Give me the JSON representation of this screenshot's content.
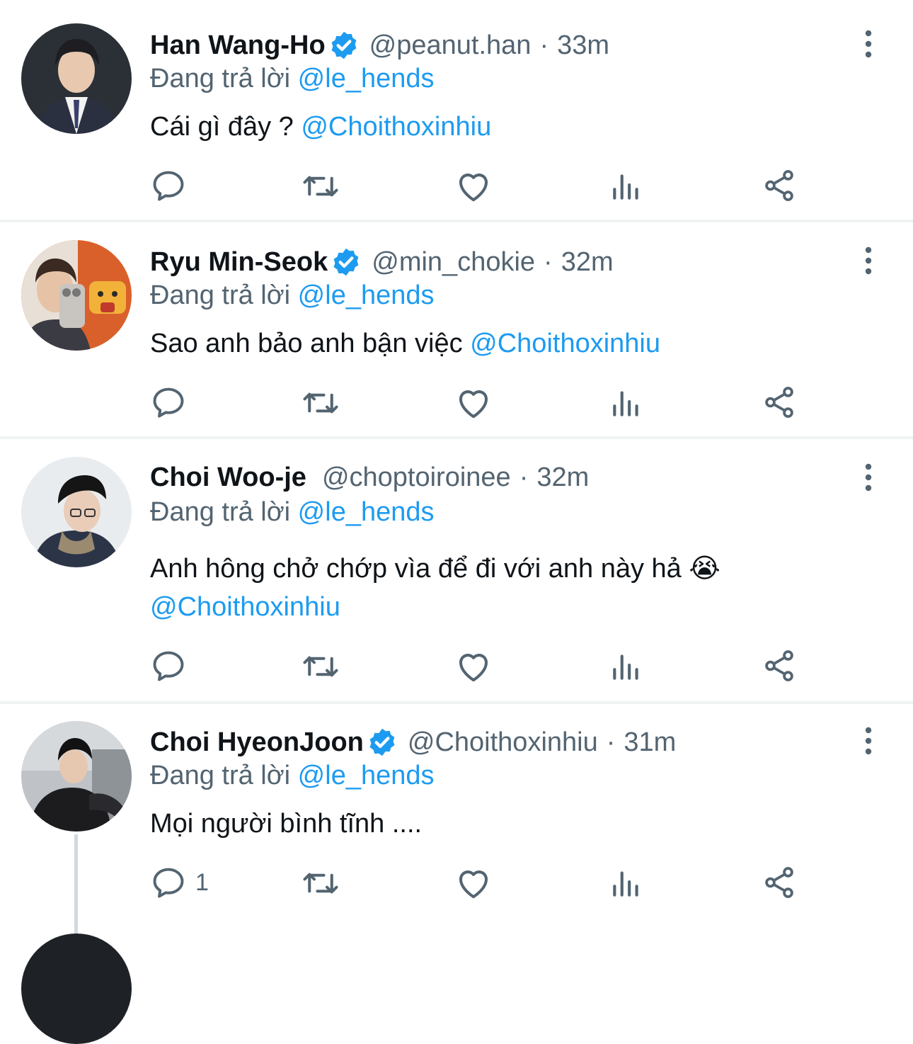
{
  "colors": {
    "accent": "#1d9bf0",
    "secondary_text": "#536471",
    "divider": "#eff3f4",
    "verified": "#1d9bf0"
  },
  "tweets": [
    {
      "display_name": "Han Wang-Ho",
      "verified": true,
      "handle": "@peanut.han",
      "separator": "·",
      "time": "33m",
      "reply_prefix": "Đang trả lời",
      "reply_handle": "@le_hends",
      "text": "Cái gì đây ?",
      "text_mention": "@Choithoxinhiu",
      "reply_count": ""
    },
    {
      "display_name": "Ryu Min-Seok",
      "verified": true,
      "handle": "@min_chokie",
      "separator": "·",
      "time": "32m",
      "reply_prefix": "Đang trả lời",
      "reply_handle": "@le_hends",
      "text": "Sao anh bảo anh bận việc",
      "text_mention": "@Choithoxinhiu",
      "reply_count": ""
    },
    {
      "display_name": "Choi Woo-je",
      "verified": false,
      "handle": "@choptoiroinee",
      "separator": "·",
      "time": "32m",
      "reply_prefix": "Đang trả lời",
      "reply_handle": "@le_hends",
      "text": "Anh hông chở chớp vìa để đi với anh này hả 😭",
      "text_mention": "@Choithoxinhiu",
      "reply_count": ""
    },
    {
      "display_name": "Choi HyeonJoon",
      "verified": true,
      "handle": "@Choithoxinhiu",
      "separator": "·",
      "time": "31m",
      "reply_prefix": "Đang trả lời",
      "reply_handle": "@le_hends",
      "text": "Mọi người bình tĩnh ....",
      "text_mention": "",
      "reply_count": "1"
    }
  ],
  "icons": [
    "reply-icon",
    "retweet-icon",
    "like-icon",
    "views-icon",
    "share-icon",
    "more-icon",
    "verified-badge-icon"
  ]
}
